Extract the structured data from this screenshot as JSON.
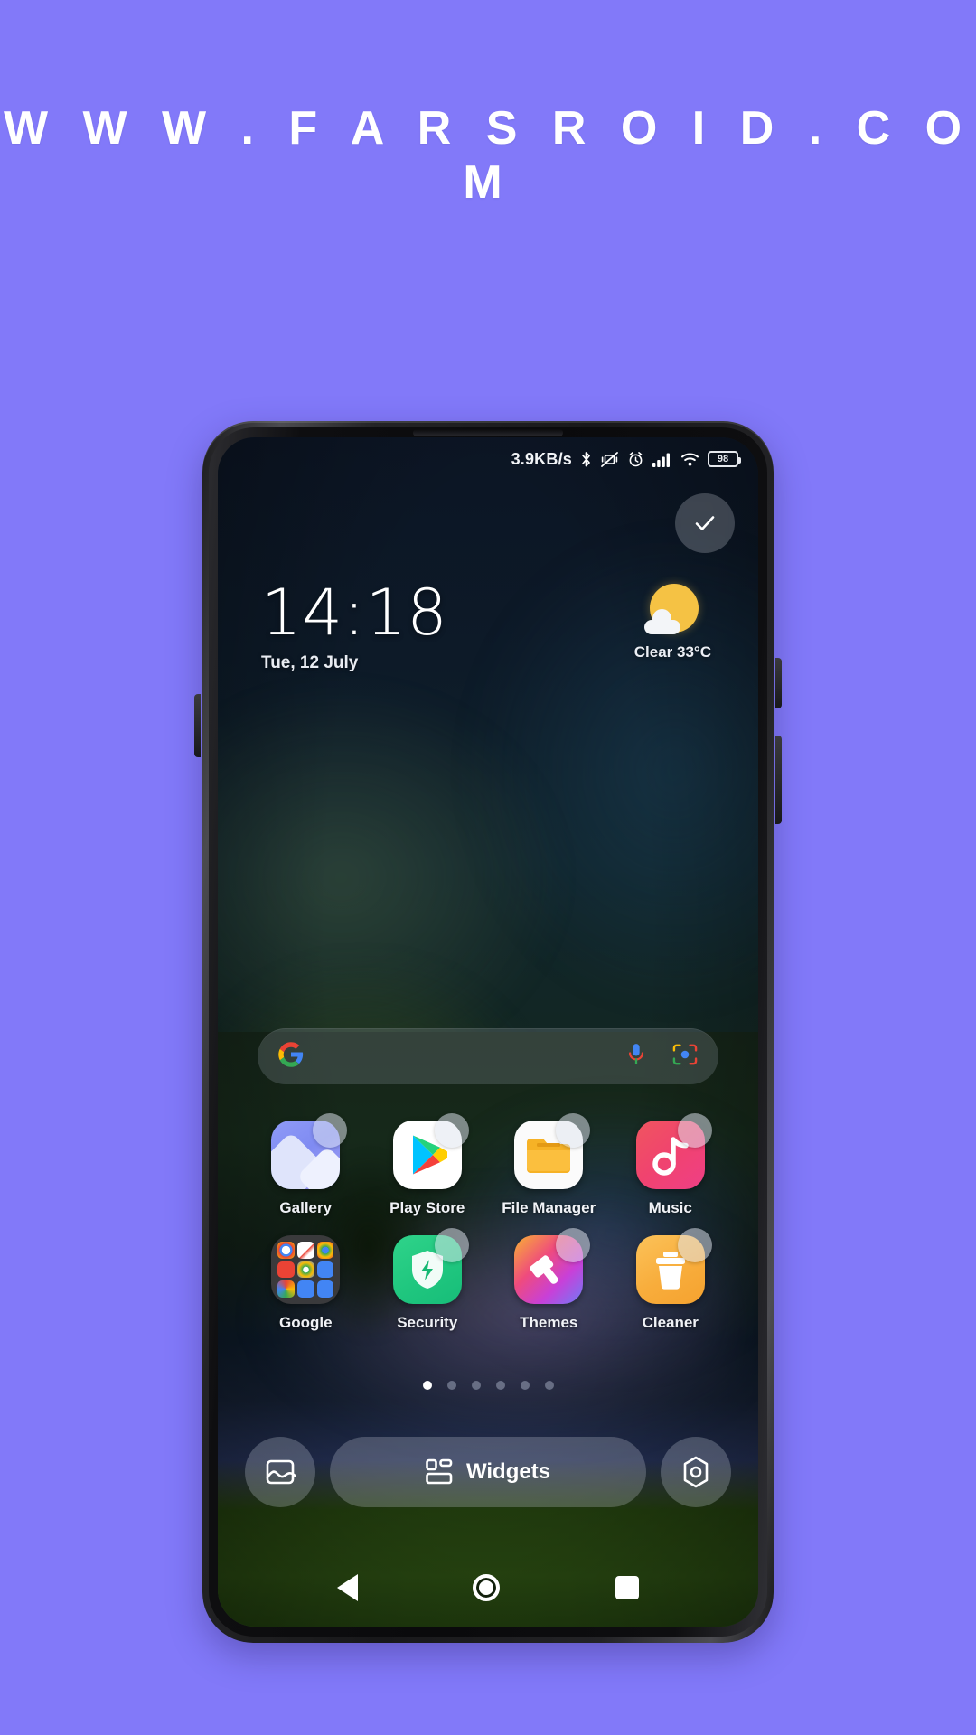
{
  "watermark": {
    "text": "W W W . F A R S R O I D . C O M"
  },
  "statusbar": {
    "network_speed": "3.9KB/s",
    "battery_level": "98",
    "icons": [
      "bluetooth-icon",
      "vibrate-off-icon",
      "alarm-icon",
      "signal-bars-icon",
      "wifi-icon",
      "battery-icon"
    ]
  },
  "edit_mode": {
    "confirm_label": "check-icon"
  },
  "clock_widget": {
    "time": "14:18",
    "date": "Tue, 12 July"
  },
  "weather_widget": {
    "condition": "Clear",
    "temperature": "33°C",
    "summary": "Clear  33°C",
    "icon": "sun-behind-cloud-icon"
  },
  "search_bar": {
    "provider_icon": "google-g-icon",
    "mic_icon": "microphone-icon",
    "lens_icon": "google-lens-icon",
    "placeholder": ""
  },
  "app_grid": {
    "rows": [
      {
        "apps": [
          {
            "label": "Gallery",
            "icon": "gallery-icon",
            "badge": true
          },
          {
            "label": "Play Store",
            "icon": "play-store-icon",
            "badge": true
          },
          {
            "label": "File Manager",
            "icon": "file-manager-icon",
            "badge": true
          },
          {
            "label": "Music",
            "icon": "music-icon",
            "badge": true
          }
        ]
      },
      {
        "apps": [
          {
            "label": "Google",
            "icon": "google-folder-icon",
            "badge": false
          },
          {
            "label": "Security",
            "icon": "security-icon",
            "badge": true
          },
          {
            "label": "Themes",
            "icon": "themes-icon",
            "badge": true
          },
          {
            "label": "Cleaner",
            "icon": "cleaner-icon",
            "badge": true
          }
        ]
      }
    ],
    "google_folder_apps": [
      "Google",
      "Gmail",
      "Chrome",
      "YouTube",
      "Drive",
      "Meet",
      "Photos",
      "Contacts",
      "Calendar"
    ]
  },
  "page_indicator": {
    "total": 6,
    "active_index": 0
  },
  "bottom_bar": {
    "wallpaper_icon": "wallpaper-icon",
    "widgets_label": "Widgets",
    "widgets_icon": "widgets-grid-icon",
    "settings_icon": "settings-gear-icon"
  },
  "nav_bar": {
    "back": "back-triangle-icon",
    "home": "home-circle-icon",
    "recents": "recents-square-icon"
  },
  "colors": {
    "page_background": "#8279f9",
    "accent_yellow": "#f5c244",
    "security_green": "#20c77f",
    "cleaner_orange": "#f8ad3c",
    "music_pink": "#ef3f86"
  }
}
